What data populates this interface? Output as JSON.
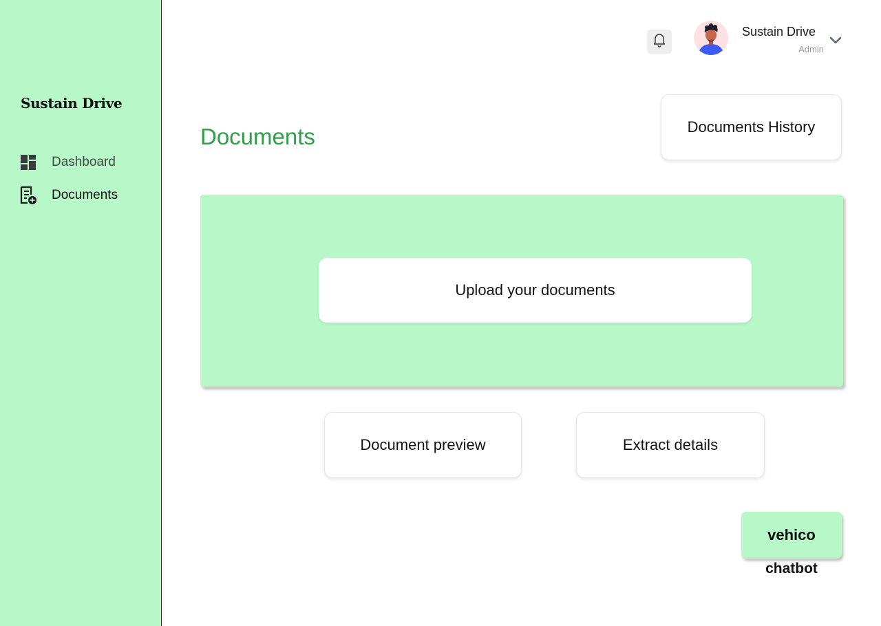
{
  "sidebar": {
    "brand": "Sustain Drive",
    "items": [
      {
        "label": "Dashboard",
        "icon": "dashboard-icon",
        "active": false
      },
      {
        "label": "Documents",
        "icon": "document-add-icon",
        "active": true
      }
    ]
  },
  "header": {
    "notification_icon": "bell-icon",
    "user": {
      "name": "Sustain Drive",
      "role": "Admin",
      "avatar_icon": "user-avatar"
    },
    "menu_icon": "chevron-down-icon"
  },
  "main": {
    "title": "Documents",
    "history_button": "Documents History",
    "upload_button": "Upload your documents",
    "preview_button": "Document preview",
    "extract_button": "Extract details"
  },
  "chatbot": {
    "button_label": "vehico",
    "caption": "chatbot"
  },
  "colors": {
    "accent_green": "#b8f7c8",
    "title_green": "#2e9e4a"
  }
}
